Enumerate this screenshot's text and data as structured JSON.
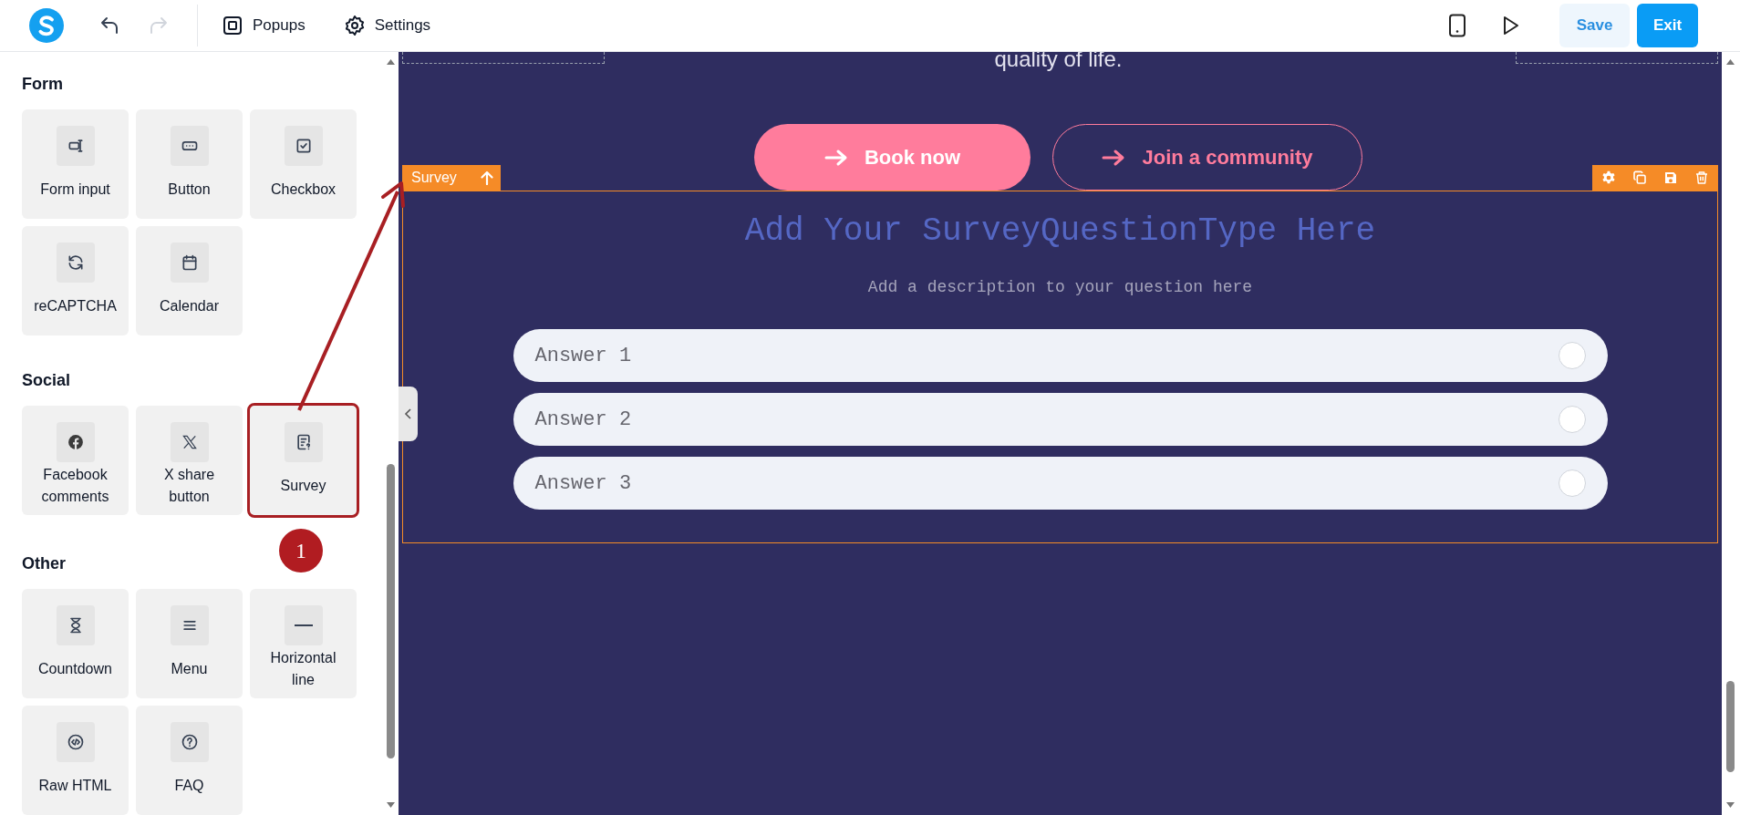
{
  "toolbar": {
    "undo": {
      "disabled": false
    },
    "redo": {
      "disabled": true
    },
    "menu": [
      {
        "label": "Popups",
        "kind": "popup"
      },
      {
        "label": "Settings",
        "kind": "gear"
      }
    ],
    "buttons": [
      {
        "label": "Save",
        "kind": "secondary"
      },
      {
        "label": "Exit",
        "kind": "primary"
      }
    ]
  },
  "sidebar": {
    "sections": [
      {
        "title": "Form",
        "items": [
          {
            "label": "Form input",
            "kind": "input",
            "highlighted": false
          },
          {
            "label": "Button",
            "kind": "button",
            "highlighted": false
          },
          {
            "label": "Checkbox",
            "kind": "checkbox",
            "highlighted": false
          },
          {
            "label": "reCAPTCHA",
            "kind": "refresh",
            "highlighted": false
          },
          {
            "label": "Calendar",
            "kind": "calendar",
            "highlighted": false
          }
        ]
      },
      {
        "title": "Social",
        "items": [
          {
            "label": "Facebook comments",
            "kind": "facebook",
            "highlighted": false
          },
          {
            "label": "X share button",
            "kind": "x",
            "highlighted": false
          },
          {
            "label": "Survey",
            "kind": "survey",
            "highlighted": true
          }
        ]
      },
      {
        "title": "Other",
        "items": [
          {
            "label": "Countdown",
            "kind": "hourglass",
            "highlighted": false
          },
          {
            "label": "Menu",
            "kind": "menu",
            "highlighted": false
          },
          {
            "label": "Horizontal line",
            "kind": "line",
            "highlighted": false
          },
          {
            "label": "Raw HTML",
            "kind": "code",
            "highlighted": false
          },
          {
            "label": "FAQ",
            "kind": "question",
            "highlighted": false
          }
        ]
      }
    ]
  },
  "annotation": {
    "number": "1"
  },
  "canvas": {
    "text": "quality of life.",
    "buttons": [
      {
        "label": "Book now",
        "kind": "filled"
      },
      {
        "label": "Join a community",
        "kind": "outline"
      }
    ],
    "selection": {
      "label": "Survey"
    },
    "survey": {
      "title": "Add Your SurveyQuestionType Here",
      "description": "Add a description to your question here",
      "answers": [
        {
          "label": "Answer 1",
          "selected": false
        },
        {
          "label": "Answer 2",
          "selected": false
        },
        {
          "label": "Answer 3",
          "selected": false
        }
      ]
    }
  }
}
